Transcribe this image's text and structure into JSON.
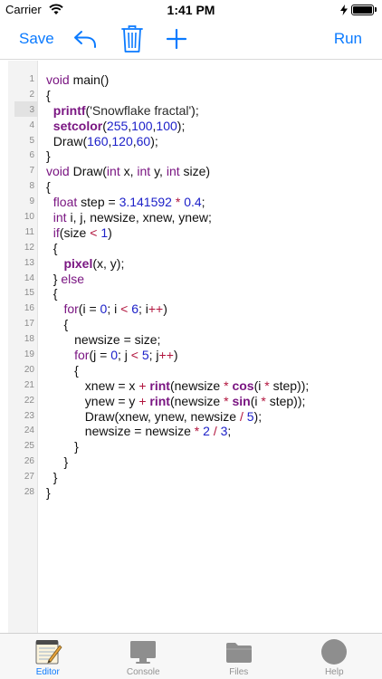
{
  "status_bar": {
    "carrier": "Carrier",
    "time": "1:41 PM"
  },
  "toolbar": {
    "save_label": "Save",
    "run_label": "Run",
    "icons": [
      "undo-icon",
      "trash-icon",
      "plus-icon"
    ],
    "accent_color": "#0a7aff"
  },
  "editor": {
    "current_line": 3,
    "lines": [
      [
        [
          "kw",
          "void"
        ],
        [
          "t",
          " main()"
        ]
      ],
      [
        [
          "t",
          "{"
        ]
      ],
      [
        [
          "t",
          "  "
        ],
        [
          "fn",
          "printf"
        ],
        [
          "t",
          "("
        ],
        [
          "str",
          "'Snowflake fractal'"
        ],
        [
          "t",
          ");"
        ]
      ],
      [
        [
          "t",
          "  "
        ],
        [
          "fn",
          "setcolor"
        ],
        [
          "t",
          "("
        ],
        [
          "num",
          "255"
        ],
        [
          "t",
          ","
        ],
        [
          "num",
          "100"
        ],
        [
          "t",
          ","
        ],
        [
          "num",
          "100"
        ],
        [
          "t",
          ");"
        ]
      ],
      [
        [
          "t",
          "  Draw("
        ],
        [
          "num",
          "160"
        ],
        [
          "t",
          ","
        ],
        [
          "num",
          "120"
        ],
        [
          "t",
          ","
        ],
        [
          "num",
          "60"
        ],
        [
          "t",
          ");"
        ]
      ],
      [
        [
          "t",
          "}"
        ]
      ],
      [
        [
          "kw",
          "void"
        ],
        [
          "t",
          " Draw("
        ],
        [
          "kw",
          "int"
        ],
        [
          "t",
          " x, "
        ],
        [
          "kw",
          "int"
        ],
        [
          "t",
          " y, "
        ],
        [
          "kw",
          "int"
        ],
        [
          "t",
          " size)"
        ]
      ],
      [
        [
          "t",
          "{"
        ]
      ],
      [
        [
          "t",
          "  "
        ],
        [
          "kw",
          "float"
        ],
        [
          "t",
          " step = "
        ],
        [
          "num",
          "3.141592"
        ],
        [
          "t",
          " "
        ],
        [
          "op",
          "*"
        ],
        [
          "t",
          " "
        ],
        [
          "num",
          "0.4"
        ],
        [
          "t",
          ";"
        ]
      ],
      [
        [
          "t",
          "  "
        ],
        [
          "kw",
          "int"
        ],
        [
          "t",
          " i, j, newsize, xnew, ynew;"
        ]
      ],
      [
        [
          "t",
          "  "
        ],
        [
          "kw",
          "if"
        ],
        [
          "t",
          "(size "
        ],
        [
          "op",
          "<"
        ],
        [
          "t",
          " "
        ],
        [
          "num",
          "1"
        ],
        [
          "t",
          ")"
        ]
      ],
      [
        [
          "t",
          "  {"
        ]
      ],
      [
        [
          "t",
          "     "
        ],
        [
          "fn",
          "pixel"
        ],
        [
          "t",
          "(x, y);"
        ]
      ],
      [
        [
          "t",
          "  } "
        ],
        [
          "kw",
          "else"
        ]
      ],
      [
        [
          "t",
          "  {"
        ]
      ],
      [
        [
          "t",
          "     "
        ],
        [
          "kw",
          "for"
        ],
        [
          "t",
          "(i = "
        ],
        [
          "num",
          "0"
        ],
        [
          "t",
          "; i "
        ],
        [
          "op",
          "<"
        ],
        [
          "t",
          " "
        ],
        [
          "num",
          "6"
        ],
        [
          "t",
          "; i"
        ],
        [
          "op",
          "++"
        ],
        [
          "t",
          ")"
        ]
      ],
      [
        [
          "t",
          "     {"
        ]
      ],
      [
        [
          "t",
          "        newsize = size;"
        ]
      ],
      [
        [
          "t",
          "        "
        ],
        [
          "kw",
          "for"
        ],
        [
          "t",
          "(j = "
        ],
        [
          "num",
          "0"
        ],
        [
          "t",
          "; j "
        ],
        [
          "op",
          "<"
        ],
        [
          "t",
          " "
        ],
        [
          "num",
          "5"
        ],
        [
          "t",
          "; j"
        ],
        [
          "op",
          "++"
        ],
        [
          "t",
          ")"
        ]
      ],
      [
        [
          "t",
          "        {"
        ]
      ],
      [
        [
          "t",
          "           xnew = x "
        ],
        [
          "op",
          "+"
        ],
        [
          "t",
          " "
        ],
        [
          "fn",
          "rint"
        ],
        [
          "t",
          "(newsize "
        ],
        [
          "op",
          "*"
        ],
        [
          "t",
          " "
        ],
        [
          "fn",
          "cos"
        ],
        [
          "t",
          "(i "
        ],
        [
          "op",
          "*"
        ],
        [
          "t",
          " step));"
        ]
      ],
      [
        [
          "t",
          "           ynew = y "
        ],
        [
          "op",
          "+"
        ],
        [
          "t",
          " "
        ],
        [
          "fn",
          "rint"
        ],
        [
          "t",
          "(newsize "
        ],
        [
          "op",
          "*"
        ],
        [
          "t",
          " "
        ],
        [
          "fn",
          "sin"
        ],
        [
          "t",
          "(i "
        ],
        [
          "op",
          "*"
        ],
        [
          "t",
          " step));"
        ]
      ],
      [
        [
          "t",
          "           Draw(xnew, ynew, newsize "
        ],
        [
          "op",
          "/"
        ],
        [
          "t",
          " "
        ],
        [
          "num",
          "5"
        ],
        [
          "t",
          ");"
        ]
      ],
      [
        [
          "t",
          "           newsize = newsize "
        ],
        [
          "op",
          "*"
        ],
        [
          "t",
          " "
        ],
        [
          "num",
          "2"
        ],
        [
          "t",
          " "
        ],
        [
          "op",
          "/"
        ],
        [
          "t",
          " "
        ],
        [
          "num",
          "3"
        ],
        [
          "t",
          ";"
        ]
      ],
      [
        [
          "t",
          "        }"
        ]
      ],
      [
        [
          "t",
          "     }"
        ]
      ],
      [
        [
          "t",
          "  }"
        ]
      ],
      [
        [
          "t",
          "}"
        ]
      ]
    ]
  },
  "tabs": [
    {
      "label": "Editor",
      "icon": "notepad-icon",
      "active": true
    },
    {
      "label": "Console",
      "icon": "monitor-icon",
      "active": false
    },
    {
      "label": "Files",
      "icon": "folder-icon",
      "active": false
    },
    {
      "label": "Help",
      "icon": "help-circle-icon",
      "active": false
    }
  ]
}
